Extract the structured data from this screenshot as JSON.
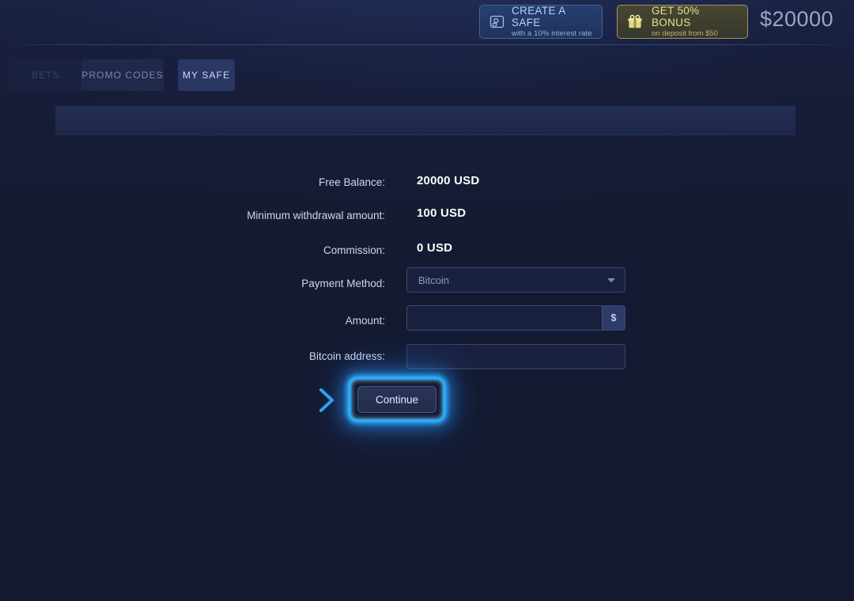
{
  "header": {
    "safe_promo": {
      "icon": "safe-icon",
      "title": "CREATE A SAFE",
      "subtitle": "with a 10% interest rate"
    },
    "bonus_promo": {
      "icon": "gift-icon",
      "title": "GET 50% BONUS",
      "subtitle": "on deposit from $50"
    },
    "balance": "$20000"
  },
  "tabs": [
    {
      "label": "BETS",
      "state": "dimmed"
    },
    {
      "label": "PROMO CODES",
      "state": "inactive"
    },
    {
      "label": "MY SAFE",
      "state": "active"
    }
  ],
  "form": {
    "rows": [
      {
        "label": "Free Balance:",
        "value": "20000 USD"
      },
      {
        "label": "Minimum withdrawal amount:",
        "value": "100 USD"
      },
      {
        "label": "Commission:",
        "value": "0 USD"
      }
    ],
    "payment_method": {
      "label": "Payment Method:",
      "value": "Bitcoin",
      "caret": "chevron-down-icon"
    },
    "amount": {
      "label": "Amount:",
      "value": "",
      "placeholder": "",
      "suffix": "$"
    },
    "address": {
      "label": "Bitcoin address:",
      "value": "",
      "placeholder": ""
    },
    "submit_label": "Continue"
  },
  "colors": {
    "background": "#141a31",
    "accent_glow": "#2aa8f5",
    "bonus_yellow": "#e8e08a",
    "safe_blue": "#b9d3f2",
    "value_text": "#ffffff",
    "label_text": "#cdd8ee"
  }
}
